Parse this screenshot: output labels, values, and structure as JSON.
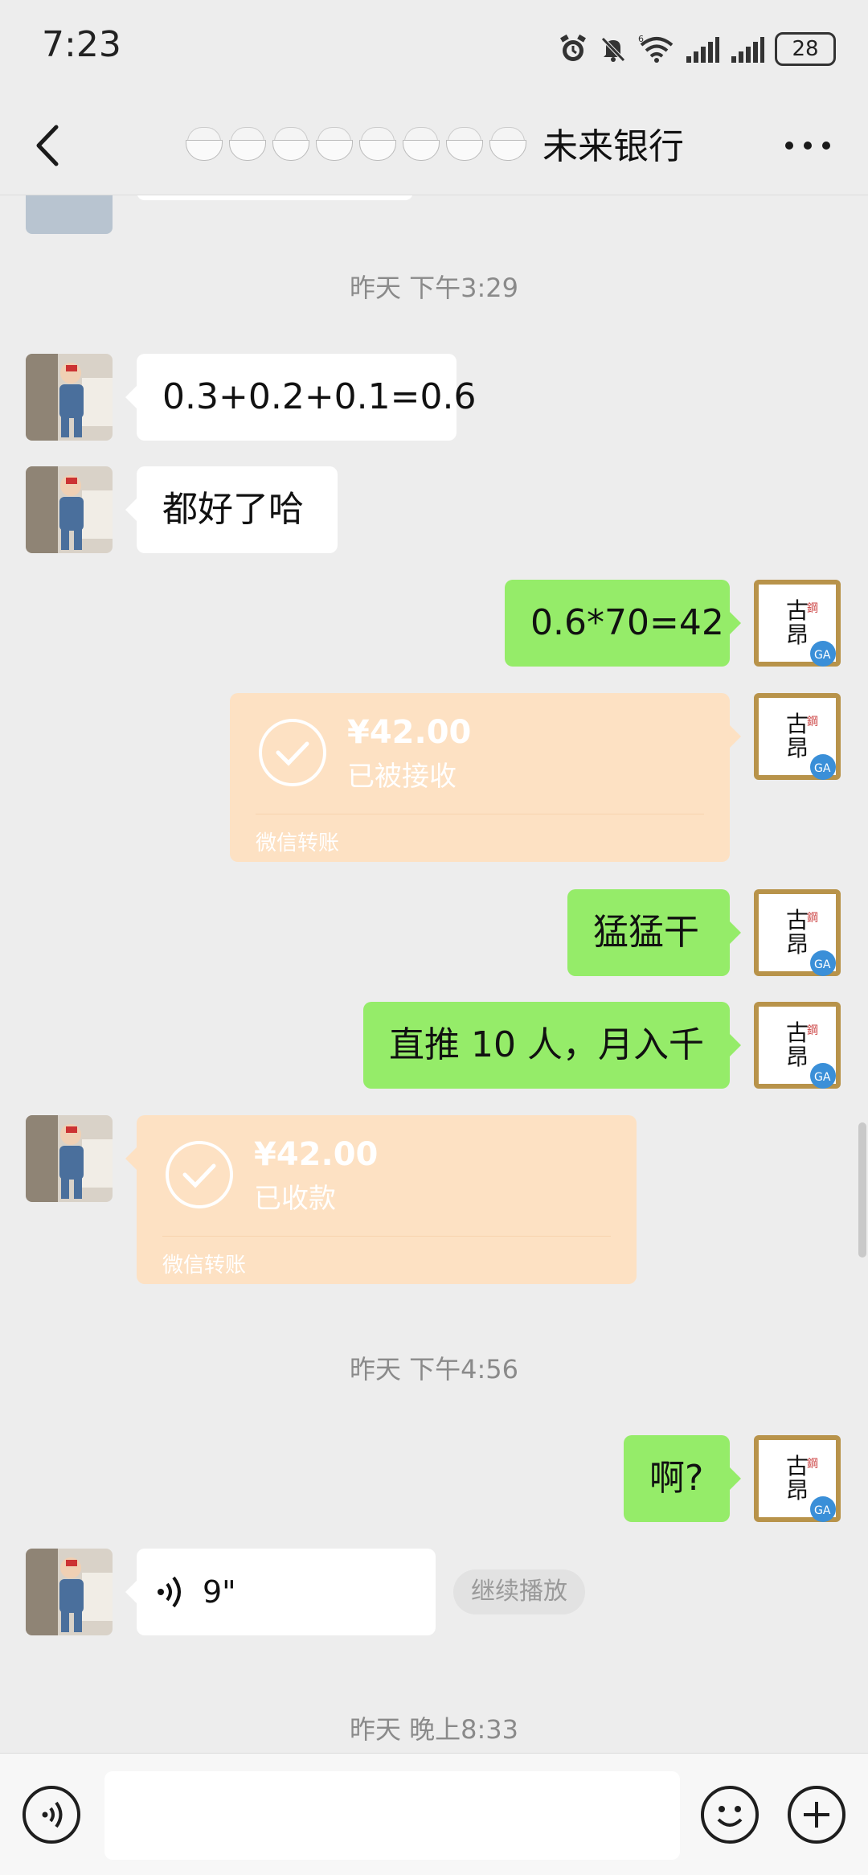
{
  "status_bar": {
    "time": "7:23",
    "battery": "28",
    "icons": [
      "alarm-icon",
      "mute-bell-icon",
      "wifi-6-icon",
      "signal-icon",
      "signal-icon",
      "battery-icon"
    ]
  },
  "nav": {
    "title": "未来银行",
    "title_prefix_emoji": [
      "rice-bowl",
      "rice-bowl",
      "rice-bowl",
      "rice-bowl",
      "rice-bowl",
      "rice-bowl",
      "rice-bowl",
      "rice-bowl"
    ]
  },
  "messages": {
    "ts1": "昨天 下午3:29",
    "m1": "0.3+0.2+0.1=0.6",
    "m2": "都好了哈",
    "m3": "0.6*70=42",
    "transfer1": {
      "amount": "¥42.00",
      "status": "已被接收",
      "footer": "微信转账"
    },
    "m4": "猛猛干",
    "m5": "直推 10 人，月入千",
    "transfer2": {
      "amount": "¥42.00",
      "status": "已收款",
      "footer": "微信转账"
    },
    "ts2": "昨天 下午4:56",
    "m6": "啊?",
    "voice": {
      "duration": "9\"",
      "continue_label": "继续播放"
    },
    "ts3": "昨天 晚上8:33"
  },
  "colors": {
    "background": "#ededed",
    "outgoing_bubble": "#95ec69",
    "incoming_bubble": "#ffffff",
    "transfer_card": "#fde1c3"
  }
}
